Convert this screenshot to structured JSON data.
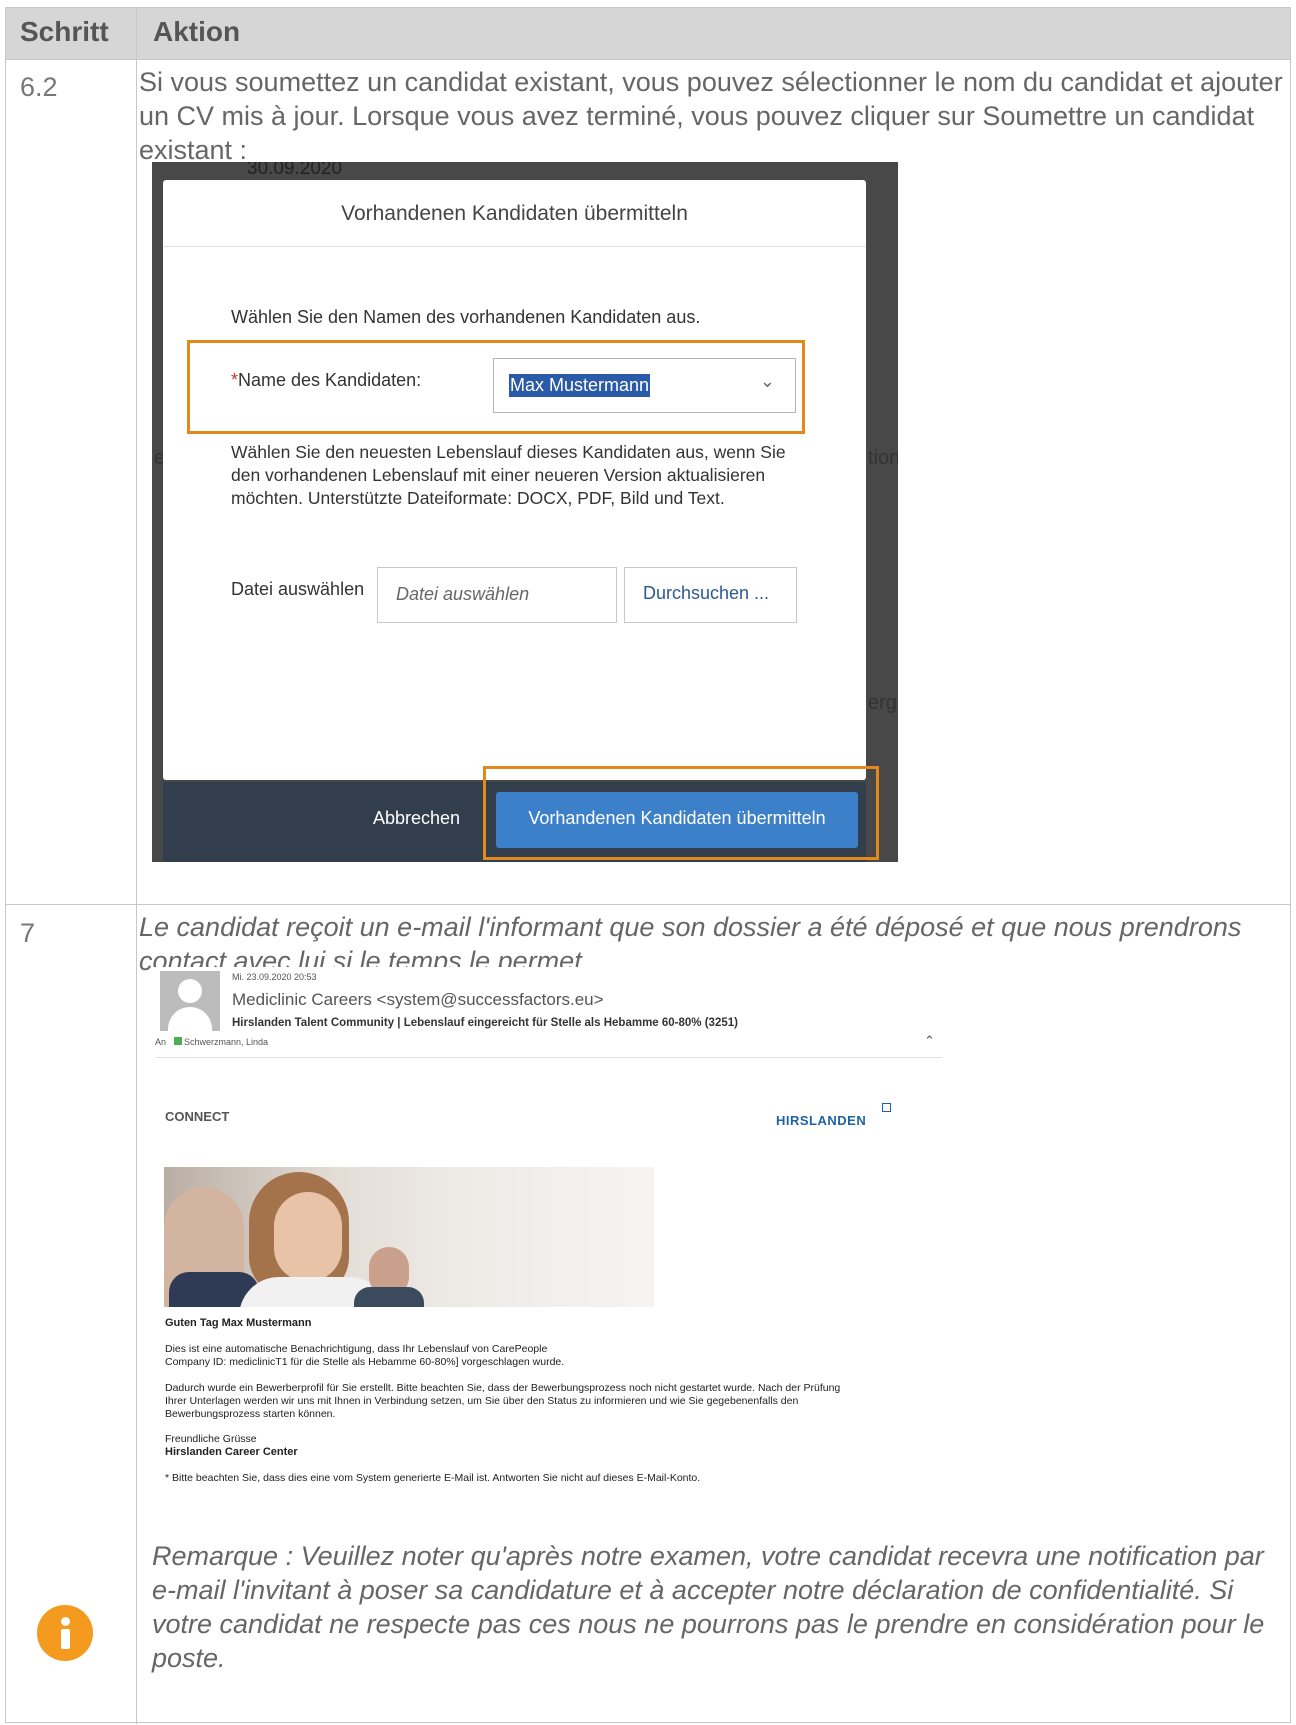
{
  "table": {
    "header": {
      "step": "Schritt",
      "action": "Aktion"
    },
    "rows": [
      {
        "step": "6.2",
        "text": "Si vous soumettez un candidat existant, vous pouvez sélectionner le nom du candidat et ajouter un CV mis à jour. Lorsque vous avez terminé, vous pouvez cliquer sur Soumettre un candidat existant :"
      },
      {
        "step": "7",
        "text": "Le candidat reçoit un e-mail l'informant que son dossier a été déposé et que nous prendrons contact avec lui si le temps le permet."
      }
    ]
  },
  "dialog": {
    "background_date": "30.09.2020",
    "title": "Vorhandenen Kandidaten übermitteln",
    "intro": "Wählen Sie den Namen des vorhandenen Kandidaten aus.",
    "required_mark": "*",
    "candidate_label": "Name des Kandidaten:",
    "candidate_value": "Max Mustermann",
    "description": "Wählen Sie den neuesten Lebenslauf dieses Kandidaten aus, wenn Sie den vorhandenen Lebenslauf mit einer neueren Version aktualisieren möchten. Unterstützte Dateiformate: DOCX, PDF, Bild und Text.",
    "file_label": "Datei auswählen",
    "file_placeholder": "Datei auswählen",
    "browse_button": "Durchsuchen ...",
    "cancel_button": "Abbrechen",
    "submit_button": "Vorhandenen Kandidaten übermitteln",
    "side_fragments": {
      "left_e": "e",
      "right_tion": "tion",
      "right_erg": "erg"
    },
    "highlight_color": "#e48a1c"
  },
  "email": {
    "date": "Mi. 23.09.2020 20:53",
    "from": "Mediclinic Careers <system@successfactors.eu>",
    "subject": "Hirslanden Talent Community | Lebenslauf eingereicht für Stelle als Hebamme 60-80% (3251)",
    "to_label": "An",
    "to_name": "Schwerzmann, Linda",
    "logo_connect": "CONNECT",
    "logo_hirslanden": "HIRSLANDEN",
    "greeting": "Guten Tag Max Mustermann",
    "para1": "Dies ist eine automatische Benachrichtigung, dass Ihr Lebenslauf von CarePeople Company ID: mediclinicT1 für die Stelle als Hebamme 60-80%] vorgeschlagen wurde.",
    "para2": "Dadurch wurde ein Bewerberprofil für Sie erstellt. Bitte beachten Sie, dass der Bewerbungsprozess noch nicht gestartet wurde. Nach der Prüfung Ihrer Unterlagen werden wir uns mit Ihnen in Verbindung setzen, um Sie über den Status zu informieren und wie Sie gegebenenfalls den Bewerbungsprozess starten können.",
    "closing": "Freundliche Grüsse",
    "signature": "Hirslanden Career Center",
    "footnote": "* Bitte beachten Sie, dass dies eine vom System generierte E-Mail ist. Antworten Sie nicht auf dieses E-Mail-Konto."
  },
  "note": {
    "icon": "info-icon",
    "icon_color": "#f39a1f",
    "text": "Remarque : Veuillez noter qu'après notre examen, votre candidat recevra une notification par e-mail l'invitant à poser sa candidature et à accepter notre déclaration de confidentialité. Si votre candidat ne respecte pas ces nous ne pourrons pas le prendre en considération pour le poste."
  }
}
